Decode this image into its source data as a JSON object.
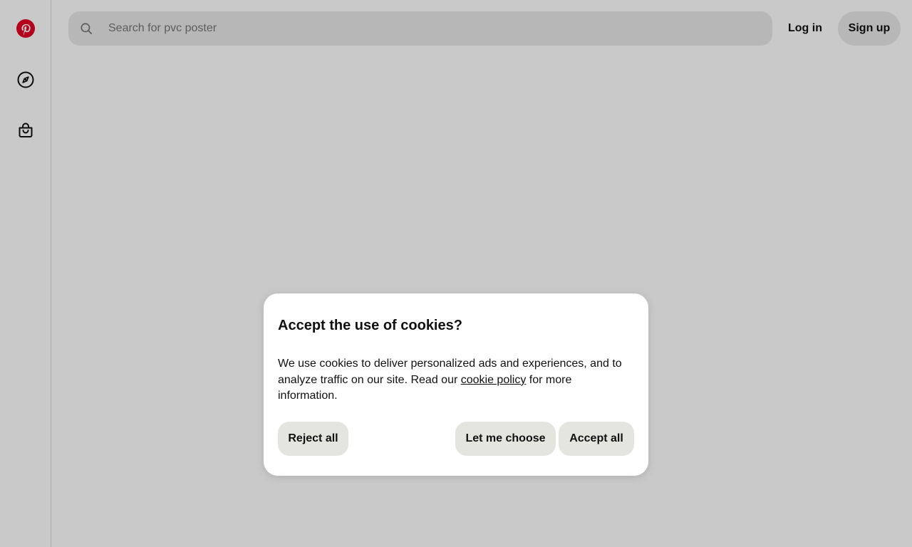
{
  "colors": {
    "brand": "#e60023",
    "search_bg": "#e9e9e9",
    "button_bg": "#e9e9e9",
    "modal_button_bg": "#e5e5e0"
  },
  "sidebar": {
    "items": [
      {
        "icon": "pinterest-logo-icon"
      },
      {
        "icon": "compass-icon"
      },
      {
        "icon": "shopping-bag-icon"
      }
    ]
  },
  "header": {
    "search": {
      "icon": "search-icon",
      "placeholder": "Search for pvc poster",
      "value": ""
    },
    "login_label": "Log in",
    "signup_label": "Sign up"
  },
  "cookie_dialog": {
    "title": "Accept the use of cookies?",
    "body_before": "We use cookies to deliver personalized ads and experiences, and to analyze traffic on our site. Read our ",
    "link_text": "cookie policy",
    "body_after": " for more information.",
    "reject_label": "Reject all",
    "choose_label": "Let me choose",
    "accept_label": "Accept all"
  }
}
